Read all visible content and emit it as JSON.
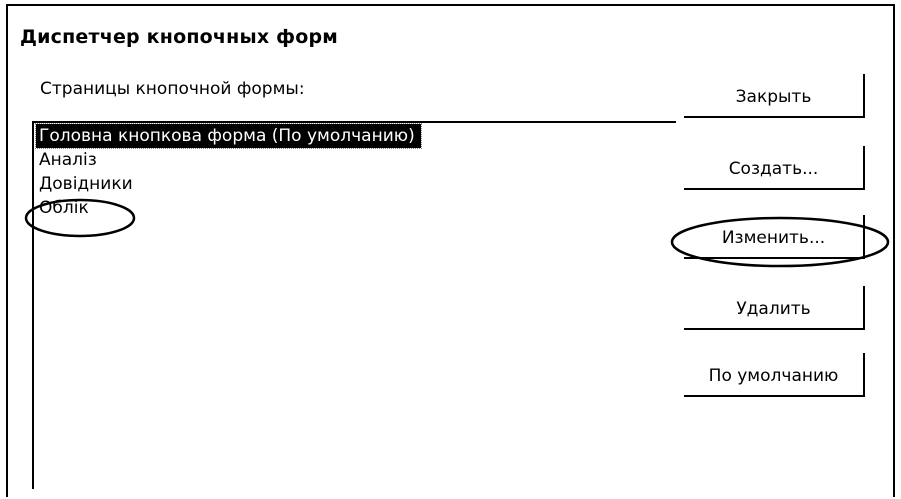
{
  "dialog": {
    "title": "Диспетчер кнопочных форм",
    "list_label": "Страницы кнопочной формы:",
    "pages": [
      {
        "label": "Головна кнопкова форма (По умолчанию)",
        "selected": true
      },
      {
        "label": "Аналіз",
        "selected": false
      },
      {
        "label": "Довідники",
        "selected": false
      },
      {
        "label": "Облік",
        "selected": false
      }
    ]
  },
  "buttons": {
    "close": "Закрыть",
    "create": "Создать...",
    "edit": "Изменить...",
    "delete": "Удалить",
    "default": "По умолчанию"
  },
  "annotations": {
    "circled_items": [
      "Облік",
      "Изменить..."
    ]
  }
}
